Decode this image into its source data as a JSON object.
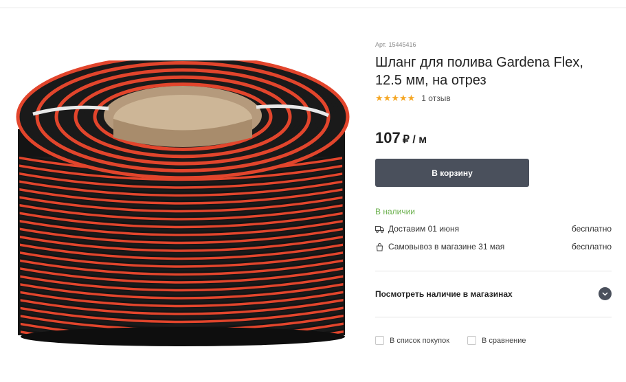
{
  "product": {
    "sku_label": "Арт.",
    "sku": "15445416",
    "title": "Шланг для полива Gardena Flex, 12.5 мм, на отрез",
    "rating": 5,
    "reviews": "1 отзыв",
    "price": "107",
    "price_unit": "₽ / м"
  },
  "actions": {
    "cart_label": "В корзину",
    "shopping_list_label": "В список покупок",
    "compare_label": "В сравнение"
  },
  "availability": {
    "status": "В наличии",
    "delivery_text": "Доставим 01 июня",
    "delivery_cost": "бесплатно",
    "pickup_text": "Самовывоз в магазине 31 мая",
    "pickup_cost": "бесплатно",
    "stores_link": "Посмотреть наличие в магазинах"
  },
  "colors": {
    "accent_dark": "#4a505c",
    "star": "#f5a623",
    "in_stock": "#6ab04c",
    "hose_red": "#e2452c",
    "hose_black": "#1a1a1a"
  },
  "icons": [
    "truck-icon",
    "bag-icon",
    "chevron-down-icon",
    "star-icon"
  ]
}
